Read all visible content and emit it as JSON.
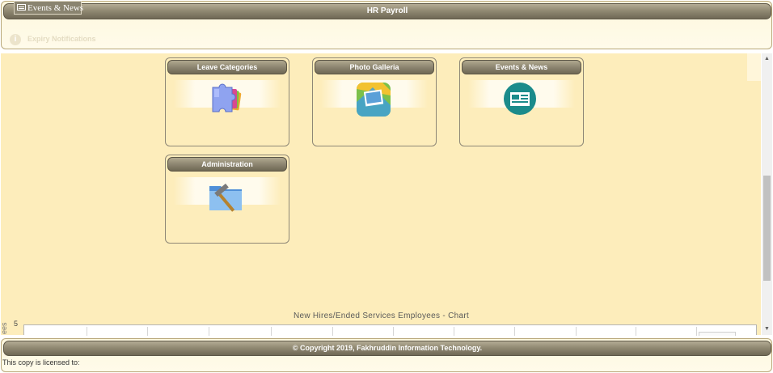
{
  "window": {
    "tab_label": "Events & News",
    "tab_icon": "newspaper-icon"
  },
  "header": {
    "title": "HR Payroll",
    "expiry_notifications": "Expiry Notifications",
    "expiry_icon": "info-icon"
  },
  "tiles": [
    {
      "title": "Leave Categories",
      "icon": "puzzle-pages-icon"
    },
    {
      "title": "Photo Galleria",
      "icon": "photo-gallery-icon"
    },
    {
      "title": "Events & News",
      "icon": "newspaper-icon"
    },
    {
      "title": "Administration",
      "icon": "folder-hammer-icon"
    }
  ],
  "chart": {
    "title": "New Hires/Ended Services Employees - Chart",
    "y_label": "ees",
    "y_tick": "5"
  },
  "chart_data": {
    "type": "bar",
    "title": "New Hires/Ended Services Employees - Chart",
    "ylabel": "ees",
    "y_ticks": [
      "5"
    ],
    "grid": true
  },
  "footer": {
    "copyright": "© Copyright 2019, Fakhruddin Information Technology.",
    "license": "This copy is licensed to:"
  },
  "colors": {
    "title_bar": "#918a73",
    "content_bg": "#fdedbb",
    "panel_border": "#b9a87a"
  }
}
